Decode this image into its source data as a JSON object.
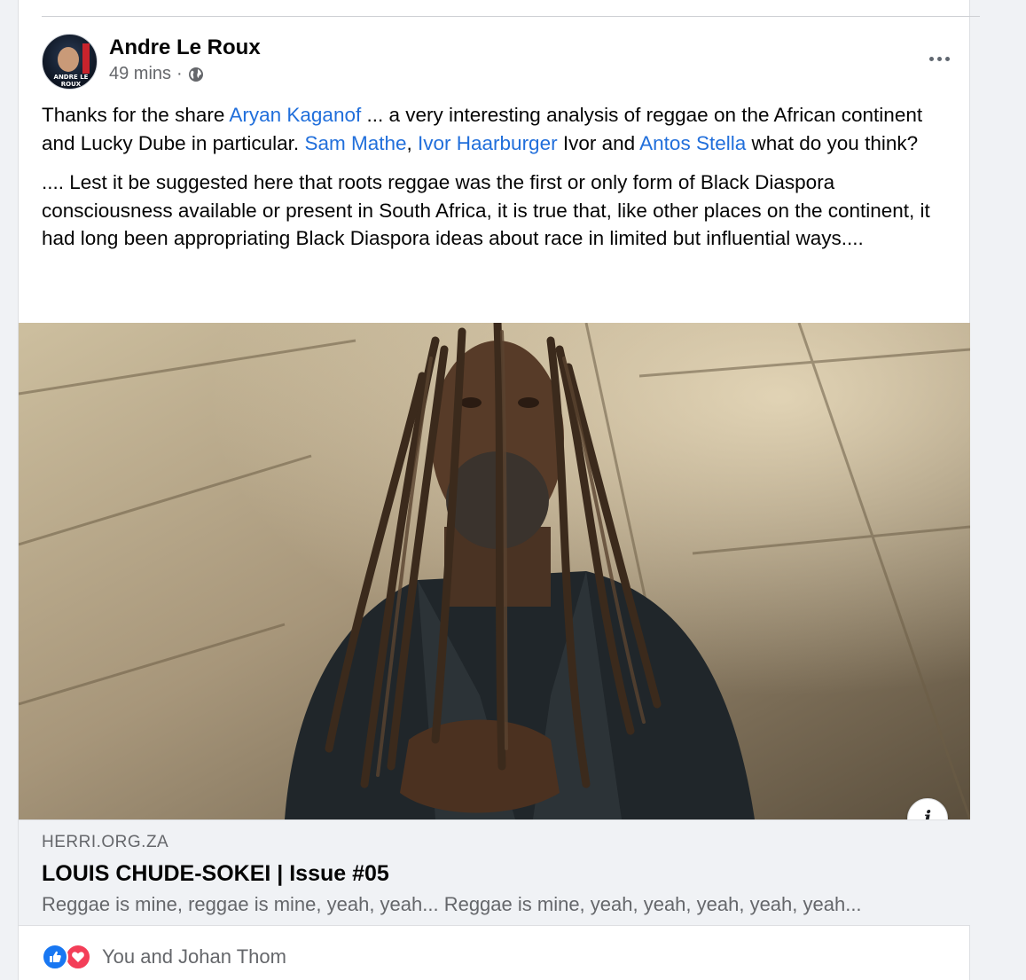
{
  "post": {
    "author": "Andre Le Roux",
    "avatar_caption": "ANDRE LE ROUX",
    "time": "49 mins",
    "separator": "·",
    "privacy_icon": "globe-icon",
    "more_icon": "more-horizontal-icon"
  },
  "body": {
    "p1": {
      "t1": "Thanks for the share ",
      "m1": "Aryan Kaganof",
      "t2": " ... a very interesting analysis of reggae on the African continent and Lucky Dube in particular. ",
      "m2": "Sam Mathe",
      "t3": ", ",
      "m3": "Ivor Haarburger",
      "t4": " Ivor and ",
      "m4": "Antos Stella",
      "t5": " what do you think?"
    },
    "p2": ".... Lest it be suggested here that roots reggae was the first or only form of Black Diaspora consciousness available or present in South Africa, it is true that, like other places on the continent, it had long been appropriating Black Diaspora ideas about race in limited but influential ways...."
  },
  "link_preview": {
    "domain": "HERRI.ORG.ZA",
    "title": "LOUIS CHUDE-SOKEI | Issue #05",
    "description": "Reggae is mine, reggae is mine, yeah, yeah... Reggae is mine, yeah, yeah, yeah, yeah, yeah...",
    "info_label": "i",
    "image": "photo of a man with long dreadlocks wearing a dark jacket against a concrete background"
  },
  "reactions": {
    "icons": [
      "like-icon",
      "love-icon"
    ],
    "text": "You and Johan Thom"
  },
  "colors": {
    "mention": "#216fdb",
    "meta": "#65676b",
    "like": "#1877f2",
    "love": "#f33e58"
  }
}
